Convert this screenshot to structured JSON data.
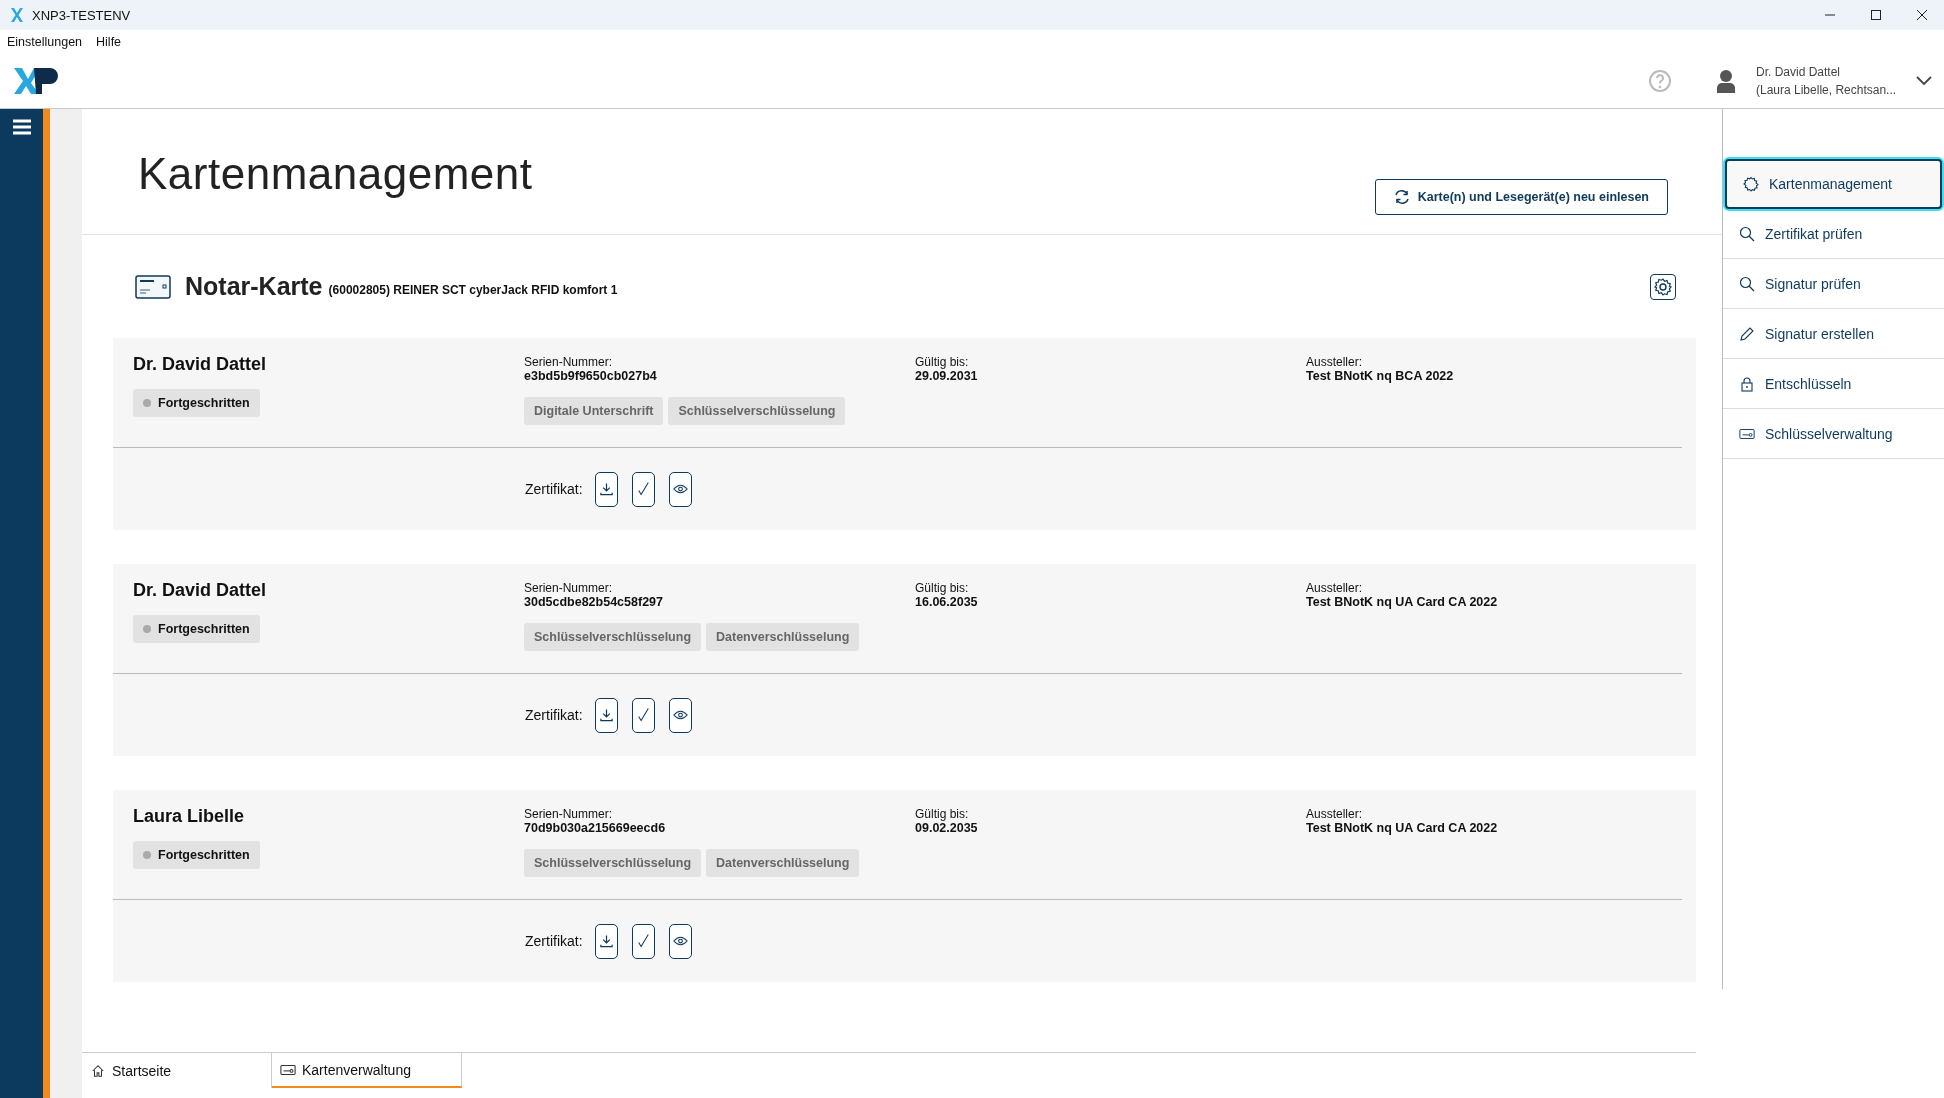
{
  "window": {
    "title": "XNP3-TESTENV"
  },
  "menu": [
    "Einstellungen",
    "Hilfe"
  ],
  "user": {
    "name": "Dr. David Dattel",
    "subtitle": "(Laura Libelle, Rechtsan..."
  },
  "page": {
    "title": "Kartenmanagement",
    "refresh_button": "Karte(n) und Lesegerät(e) neu einlesen"
  },
  "card": {
    "title": "Notar-Karte",
    "subtitle": "(60002805) REINER SCT cyberJack RFID komfort 1",
    "certificates": [
      {
        "name": "Dr. David Dattel",
        "level": "Fortgeschritten",
        "serial_label": "Serien-Nummer:",
        "serial": "e3bd5b9f9650cb027b4",
        "tags": [
          "Digitale Unterschrift",
          "Schlüsselverschlüsselung"
        ],
        "valid_label": "Gültig bis:",
        "valid": "29.09.2031",
        "issuer_label": "Aussteller:",
        "issuer": "Test BNotK nq BCA 2022",
        "cert_label": "Zertifikat:"
      },
      {
        "name": "Dr. David Dattel",
        "level": "Fortgeschritten",
        "serial_label": "Serien-Nummer:",
        "serial": "30d5cdbe82b54c58f297",
        "tags": [
          "Schlüsselverschlüsselung",
          "Datenverschlüsselung"
        ],
        "valid_label": "Gültig bis:",
        "valid": "16.06.2035",
        "issuer_label": "Aussteller:",
        "issuer": "Test BNotK nq UA Card CA 2022",
        "cert_label": "Zertifikat:"
      },
      {
        "name": "Laura Libelle",
        "level": "Fortgeschritten",
        "serial_label": "Serien-Nummer:",
        "serial": "70d9b030a215669eecd6",
        "tags": [
          "Schlüsselverschlüsselung",
          "Datenverschlüsselung"
        ],
        "valid_label": "Gültig bis:",
        "valid": "09.02.2035",
        "issuer_label": "Aussteller:",
        "issuer": "Test BNotK nq UA Card CA 2022",
        "cert_label": "Zertifikat:"
      }
    ]
  },
  "sidebar": {
    "items": [
      {
        "kind": "gear",
        "label": "Kartenmanagement",
        "selected": true
      },
      {
        "kind": "search",
        "label": "Zertifikat prüfen",
        "selected": false
      },
      {
        "kind": "search",
        "label": "Signatur prüfen",
        "selected": false
      },
      {
        "kind": "pencil",
        "label": "Signatur erstellen",
        "selected": false
      },
      {
        "kind": "lock",
        "label": "Entschlüsseln",
        "selected": false
      },
      {
        "kind": "key",
        "label": "Schlüsselverwaltung",
        "selected": false
      }
    ]
  },
  "tabs": [
    {
      "kind": "home",
      "label": "Startseite",
      "selected": false
    },
    {
      "kind": "key",
      "label": "Kartenverwaltung",
      "selected": true
    }
  ]
}
